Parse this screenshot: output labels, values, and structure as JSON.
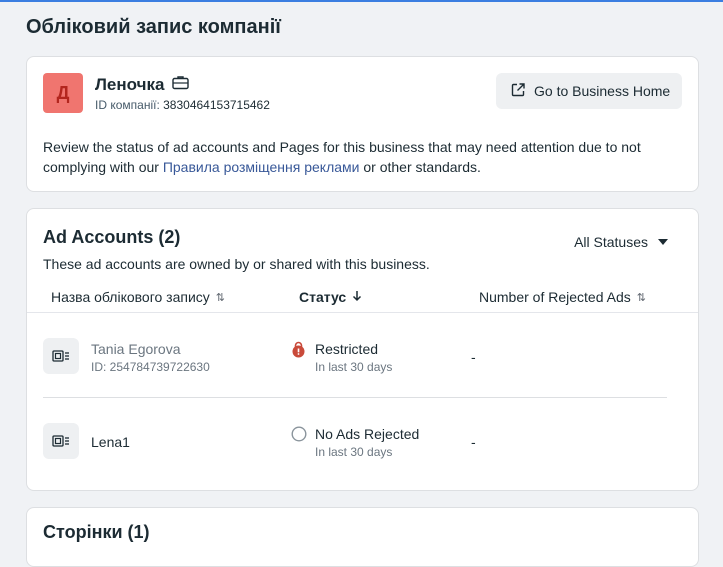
{
  "page": {
    "title": "Обліковий запис компанії"
  },
  "business": {
    "avatar_letter": "Д",
    "name": "Леночка",
    "id_label": "ID компанії:",
    "id_value": "3830464153715462",
    "home_button": "Go to Business Home",
    "description_before": "Review the status of ad accounts and Pages for this business that may need attention due to not complying with our ",
    "description_link": "Правила розміщення реклами",
    "description_after": " or other standards."
  },
  "ad_accounts": {
    "title": "Ad Accounts (2)",
    "subtitle": "These ad accounts are owned by or shared with this business.",
    "status_filter": "All Statuses",
    "columns": [
      "Назва облікового запису",
      "Статус",
      "Number of Rejected Ads"
    ],
    "rows": [
      {
        "name": "Tania Egorova",
        "id": "ID: 254784739722630",
        "status": "Restricted",
        "status_sub": "In last 30 days",
        "rejected": "-"
      },
      {
        "name": "Lena1",
        "id": "",
        "status": "No Ads Rejected",
        "status_sub": "In last 30 days",
        "rejected": "-"
      }
    ]
  },
  "pages_section": {
    "title": "Сторінки (1)"
  },
  "colors": {
    "accent": "#3b7ee1",
    "avatar_bg": "#f0756f",
    "restricted": "#c94a3a",
    "link": "#385898"
  }
}
